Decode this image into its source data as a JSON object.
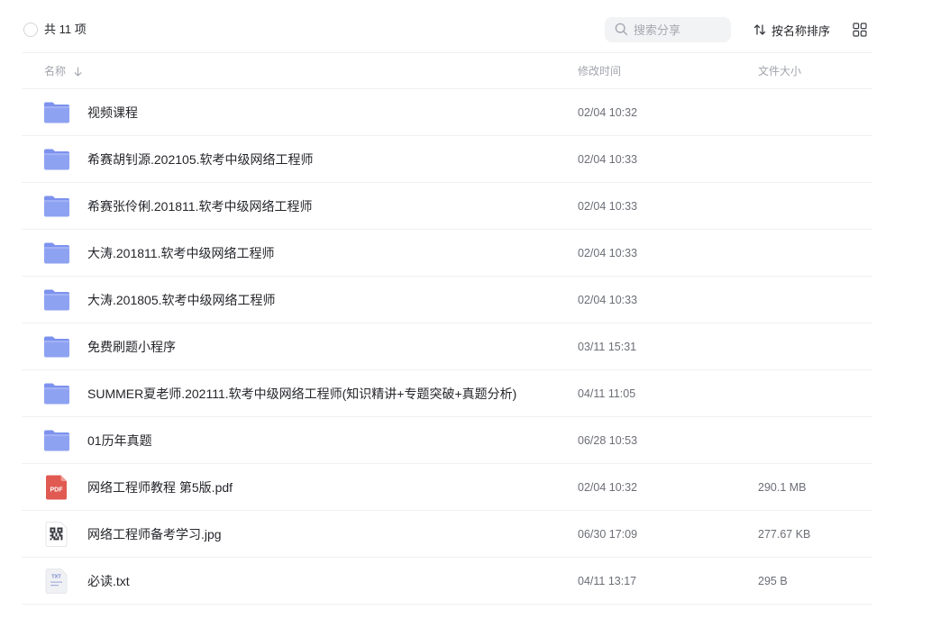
{
  "toolbar": {
    "count_label": "共 11 项",
    "search_placeholder": "搜索分享",
    "sort_label": "按名称排序"
  },
  "table": {
    "columns": {
      "name": "名称",
      "modified": "修改时间",
      "size": "文件大小"
    },
    "rows": [
      {
        "icon": "folder-icon",
        "name": "视频课程",
        "modified": "02/04 10:32",
        "size": ""
      },
      {
        "icon": "folder-icon",
        "name": "希赛胡钊源.202105.软考中级网络工程师",
        "modified": "02/04 10:33",
        "size": ""
      },
      {
        "icon": "folder-icon",
        "name": "希赛张伶俐.201811.软考中级网络工程师",
        "modified": "02/04 10:33",
        "size": ""
      },
      {
        "icon": "folder-icon",
        "name": "大涛.201811.软考中级网络工程师",
        "modified": "02/04 10:33",
        "size": ""
      },
      {
        "icon": "folder-icon",
        "name": "大涛.201805.软考中级网络工程师",
        "modified": "02/04 10:33",
        "size": ""
      },
      {
        "icon": "folder-icon",
        "name": "免费刷题小程序",
        "modified": "03/11 15:31",
        "size": ""
      },
      {
        "icon": "folder-icon",
        "name": "SUMMER夏老师.202111.软考中级网络工程师(知识精讲+专题突破+真题分析)",
        "modified": "04/11 11:05",
        "size": ""
      },
      {
        "icon": "folder-icon",
        "name": "01历年真题",
        "modified": "06/28 10:53",
        "size": ""
      },
      {
        "icon": "pdf-file-icon",
        "badge": "PDF",
        "name": "网络工程师教程 第5版.pdf",
        "modified": "02/04 10:32",
        "size": "290.1 MB"
      },
      {
        "icon": "qr-image-icon",
        "name": "网络工程师备考学习.jpg",
        "modified": "06/30 17:09",
        "size": "277.67 KB"
      },
      {
        "icon": "txt-file-icon",
        "badge": "TXT",
        "name": "必读.txt",
        "modified": "04/11 13:17",
        "size": "295 B"
      }
    ]
  },
  "colors": {
    "folder": "#8ea2f2",
    "folder_tab": "#7d92ee",
    "pdf": "#e05a52",
    "divider": "#eff0f2"
  }
}
